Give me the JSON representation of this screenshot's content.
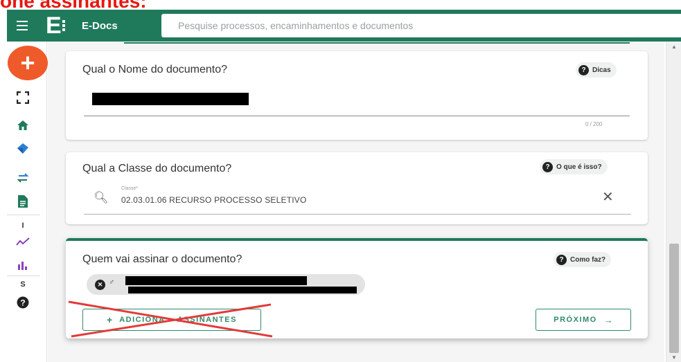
{
  "annotation": {
    "title": "one assinantes:"
  },
  "header": {
    "app_name": "E-Docs",
    "logo_letter": "E",
    "search_placeholder": "Pesquise processos, encaminhamentos e documentos"
  },
  "sidebar": {
    "items": [
      {
        "icon": "plus-icon"
      },
      {
        "icon": "fullscreen-icon"
      },
      {
        "icon": "home-icon"
      },
      {
        "icon": "box-icon"
      },
      {
        "icon": "transfer-icon"
      },
      {
        "icon": "document-icon"
      },
      {
        "label": "I"
      },
      {
        "icon": "trend-icon"
      },
      {
        "icon": "bar-chart-icon"
      },
      {
        "label": "S"
      },
      {
        "icon": "help-icon"
      }
    ]
  },
  "form": {
    "name_card": {
      "heading": "Qual o Nome do documento?",
      "help_label": "Dicas",
      "counter": "0 / 200"
    },
    "class_card": {
      "heading": "Qual a Classe do documento?",
      "help_label": "O que é isso?",
      "field_label": "Classe*",
      "field_value": "02.03.01.06 RECURSO PROCESSO SELETIVO"
    },
    "signer_card": {
      "heading": "Quem vai assinar o documento?",
      "help_label": "Como faz?",
      "add_button_label": "ADICIONAR ASSINANTES",
      "add_button_visible": "ADICIONA    ASSINANTES",
      "next_button_label": "PRÓXIMO"
    }
  },
  "colors": {
    "brand": "#1f7a5c",
    "fab": "#ef5a2a",
    "annotation": "#e8170f",
    "cross_out": "#e23a3a"
  }
}
